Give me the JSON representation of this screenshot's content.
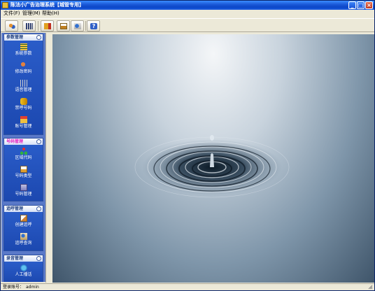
{
  "window": {
    "title": "陈法小广告治理系统【城管专用】"
  },
  "menu": {
    "items": [
      "文件(F)",
      "管理(M)",
      "帮助(H)"
    ]
  },
  "sidebar": {
    "groups": [
      {
        "title": "参数管理",
        "items": [
          "系统参数",
          "修改密码",
          "语音管理",
          "禁呼号码",
          "账号管理"
        ]
      },
      {
        "title": "号码管理",
        "items": [
          "区域代码",
          "号码类型",
          "号码管理"
        ]
      },
      {
        "title": "追呼管理",
        "items": [
          "创建追呼",
          "追呼查询"
        ]
      },
      {
        "title": "录音管理",
        "items": [
          "人工播话"
        ]
      }
    ]
  },
  "status": {
    "label": "登录账号：",
    "user": "admin"
  },
  "colors": {
    "titlebar": "#0b46c8",
    "sidebar": "#5a79c8",
    "active_group": "#e020c0"
  }
}
